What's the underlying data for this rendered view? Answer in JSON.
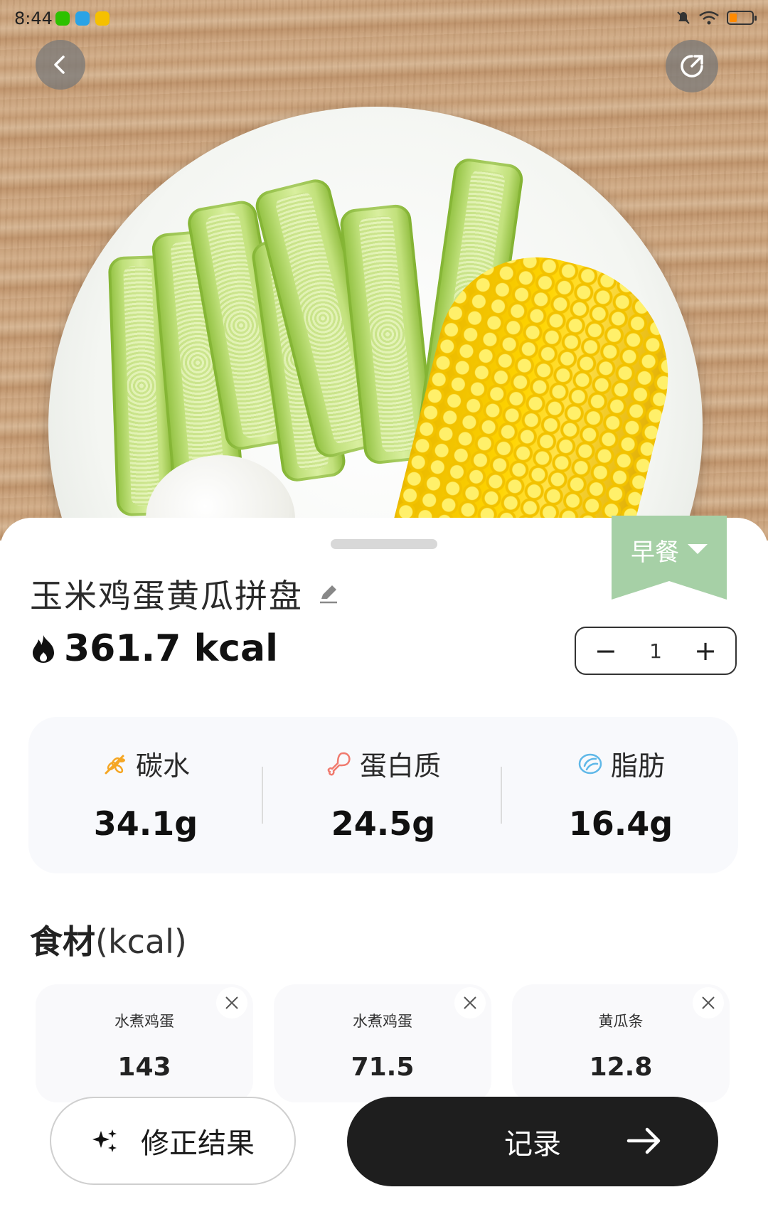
{
  "status_bar": {
    "time": "8:44",
    "app_icons": [
      "wechat-icon",
      "app-icon",
      "weibo-icon"
    ],
    "right_icons": [
      "mute-icon",
      "wifi-icon",
      "battery-icon"
    ],
    "battery_level": 0.25
  },
  "top_bar": {
    "back_icon": "chevron-left-icon",
    "share_icon": "share-icon"
  },
  "meal": {
    "type_label": "早餐",
    "color": "#a6d0a6"
  },
  "dish": {
    "title": "玉米鸡蛋黄瓜拼盘",
    "calories": "361.7 kcal",
    "quantity": "1"
  },
  "macros": [
    {
      "label": "碳水",
      "value": "34.1g",
      "icon": "wheat-icon",
      "color": "#f5a623"
    },
    {
      "label": "蛋白质",
      "value": "24.5g",
      "icon": "drumstick-icon",
      "color": "#f07a6e"
    },
    {
      "label": "脂肪",
      "value": "16.4g",
      "icon": "oil-drop-icon",
      "color": "#5fb8e8"
    }
  ],
  "ingredients": {
    "title": "食材",
    "unit": "(kcal)",
    "items": [
      {
        "name": "水煮鸡蛋",
        "kcal": "143"
      },
      {
        "name": "水煮鸡蛋",
        "kcal": "71.5"
      },
      {
        "name": "黄瓜条",
        "kcal": "12.8"
      }
    ]
  },
  "actions": {
    "fix_label": "修正结果",
    "record_label": "记录"
  }
}
